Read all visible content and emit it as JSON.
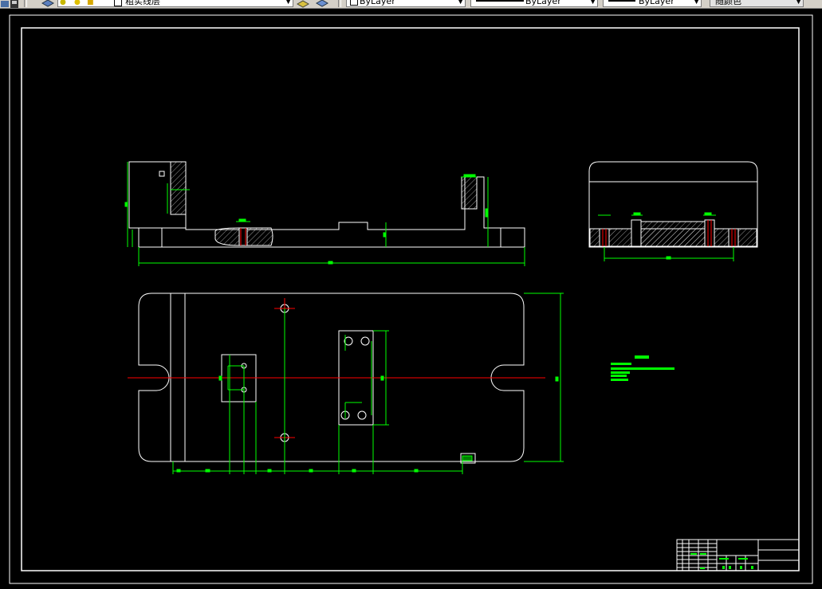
{
  "toolbar": {
    "layer_name": "粗实线层",
    "color": "ByLayer",
    "linetype": "ByLayer",
    "lineweight": "ByLayer",
    "plotstyle": "随颜色"
  },
  "drawing": {
    "background": "#000000",
    "colors": {
      "outline": "#ffffff",
      "dimension": "#00ff00",
      "centerline": "#ff0000",
      "hidden": "#ff0000"
    }
  }
}
